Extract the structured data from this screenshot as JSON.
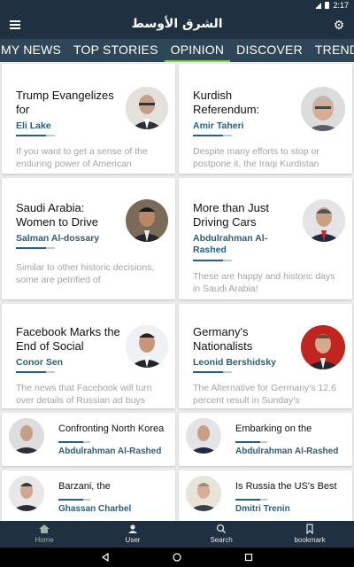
{
  "status_bar": {
    "time": "2:17"
  },
  "header": {
    "logo": "الشرق الأوسط"
  },
  "tabs": [
    {
      "label": "MY NEWS"
    },
    {
      "label": "TOP STORIES"
    },
    {
      "label": "OPINION",
      "active": true
    },
    {
      "label": "DISCOVER"
    },
    {
      "label": "TRENDING"
    }
  ],
  "cards": [
    {
      "title": "Trump Evangelizes for",
      "author": "Eli Lake",
      "excerpt": "If you want to get a sense of the enduring power of American"
    },
    {
      "title": "Kurdish Referendum:",
      "author": "Amir Taheri",
      "excerpt": "Despite many efforts to stop or postpone it, the Iraqi Kurdistan"
    },
    {
      "title": "Saudi Arabia: Women to Drive",
      "author": "Salman Al-dossary",
      "excerpt": "Similar to other historic decisions, some are petrified of"
    },
    {
      "title": "More than Just Driving Cars",
      "author": "Abdulrahman Al-Rashed",
      "excerpt": "These are happy and historic days in Saudi Arabia!"
    },
    {
      "title": "Facebook Marks the End of Social",
      "author": "Conor Sen",
      "excerpt": "The news that Facebook will turn over details of Russian ad buys"
    },
    {
      "title": "Germany's Nationalists",
      "author": "Leonid Bershidsky",
      "excerpt": "The Alternative for Germany's 12.6 percent result in Sunday's"
    }
  ],
  "rows": [
    {
      "title": "Confronting North Korea",
      "author": "Abdulrahman Al-Rashed"
    },
    {
      "title": "Embarking on the",
      "author": "Abdulrahman Al-Rashed"
    },
    {
      "title": "Barzani, the",
      "author": "Ghassan Charbel"
    },
    {
      "title": "Is Russia the US's Best",
      "author": "Dmitri Trenin"
    }
  ],
  "bottom_nav": [
    {
      "label": "Home",
      "icon": "home-icon"
    },
    {
      "label": "User",
      "icon": "user-icon"
    },
    {
      "label": "Search",
      "icon": "search-icon"
    },
    {
      "label": "bookmark",
      "icon": "bookmark-icon"
    }
  ],
  "colors": {
    "bar": "#1f3140",
    "tabs": "#2e4657",
    "accent": "#7fd14a",
    "author": "#2a5f7d"
  }
}
